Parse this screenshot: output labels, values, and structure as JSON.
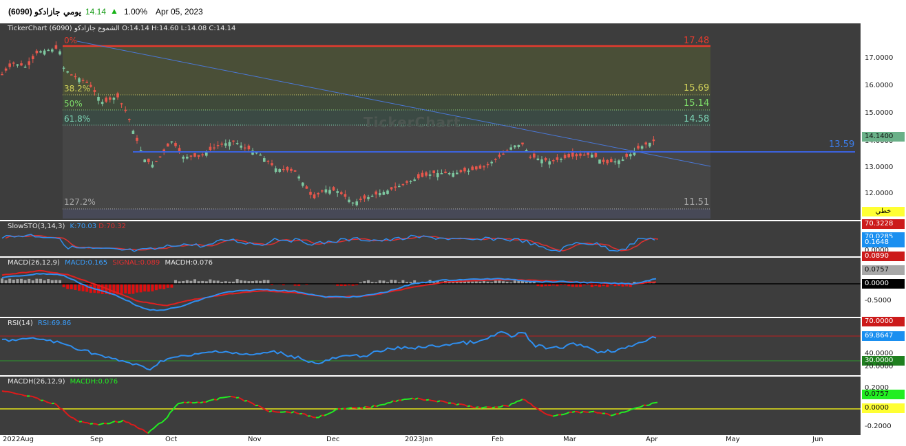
{
  "header": {
    "symbol": "جازادكو (6090)",
    "period": "يومي",
    "last": "14.14",
    "change_pct": "1.00%",
    "date": "Apr 05, 2023"
  },
  "main": {
    "title": "TickerChart الشموع جازادكو (6090) O:14.14 H:14.60 L:14.08 C:14.14",
    "fib": [
      {
        "pct": "0%",
        "value": "17.48"
      },
      {
        "pct": "38.2%",
        "value": "15.69"
      },
      {
        "pct": "50%",
        "value": "15.14"
      },
      {
        "pct": "61.8%",
        "value": "14.58"
      },
      {
        "pct": "127.2%",
        "value": "11.51"
      }
    ],
    "hline_value": "13.59",
    "watermark": "TickerChart",
    "axis": [
      "17.0000",
      "16.0000",
      "15.0000",
      "14.0000",
      "13.0000",
      "12.0000"
    ],
    "price_tag": "14.1400",
    "line_tag": "خطي"
  },
  "stoch": {
    "name": "SlowSTO(3,14,3)",
    "k": "K:70.03",
    "d": "D:70.32",
    "tags": [
      "70.3228",
      "70.0285",
      "0.1648",
      "0.0000",
      "0.0890"
    ]
  },
  "macd": {
    "name": "MACD(26,12,9)",
    "macd": "MACD:0.165",
    "signal": "SIGNAL:0.089",
    "hist": "MACDH:0.076",
    "tags": [
      "0.0757",
      "0.0000"
    ],
    "axis": [
      "-0.5000"
    ]
  },
  "rsi": {
    "name": "RSI(14)",
    "value": "RSI:69.86",
    "tags": [
      "70.0000",
      "69.8647",
      "30.0000"
    ],
    "axis": [
      "40.0000",
      "20.0000"
    ]
  },
  "macdh": {
    "name": "MACDH(26,12,9)",
    "value": "MACDH:0.076",
    "tags": [
      "0.0757",
      "0.0000"
    ],
    "axis": [
      "0.2000",
      "-0.2000"
    ]
  },
  "xaxis": [
    "2022Aug",
    "Sep",
    "Oct",
    "Nov",
    "Dec",
    "2023Jan",
    "Feb",
    "Mar",
    "Apr",
    "May",
    "Jun"
  ],
  "colors": {
    "up": "#7ec8a0",
    "down": "#e8574c",
    "fibline": "#e63b2e",
    "hline": "#3c63e0",
    "trend": "#4a78d8"
  }
}
